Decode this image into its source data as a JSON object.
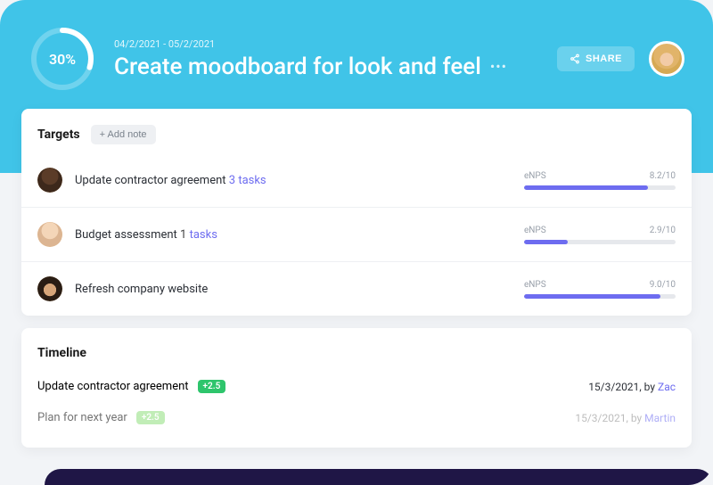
{
  "header": {
    "date_range": "04/2/2021 - 05/2/2021",
    "title": "Create moodboard for look and feel",
    "progress_pct_label": "30%",
    "progress_pct": 30,
    "share_label": "SHARE"
  },
  "targets": {
    "heading": "Targets",
    "add_note_label": "+ Add note",
    "metric_label": "eNPS",
    "metric_max": 10,
    "items": [
      {
        "title": "Update contractor agreement",
        "sub_count": "3",
        "sub_label": "tasks",
        "score": "8.2/10",
        "fill": 82
      },
      {
        "title": "Budget assessment",
        "sub_count": "1",
        "sub_label": "tasks",
        "score": "2.9/10",
        "fill": 29
      },
      {
        "title": "Refresh company website",
        "sub_count": "",
        "sub_label": "",
        "score": "9.0/10",
        "fill": 90
      }
    ]
  },
  "timeline": {
    "heading": "Timeline",
    "items": [
      {
        "title": "Update contractor agreement",
        "badge": "+2.5",
        "date": "15/3/2021",
        "by_label": "by",
        "user": "Zac",
        "faded": false,
        "badge_variant": "green"
      },
      {
        "title": "Plan for next year",
        "badge": "+2.5",
        "date": "15/3/2021",
        "by_label": "by",
        "user": "Martin",
        "faded": true,
        "badge_variant": "lightgreen"
      }
    ]
  }
}
